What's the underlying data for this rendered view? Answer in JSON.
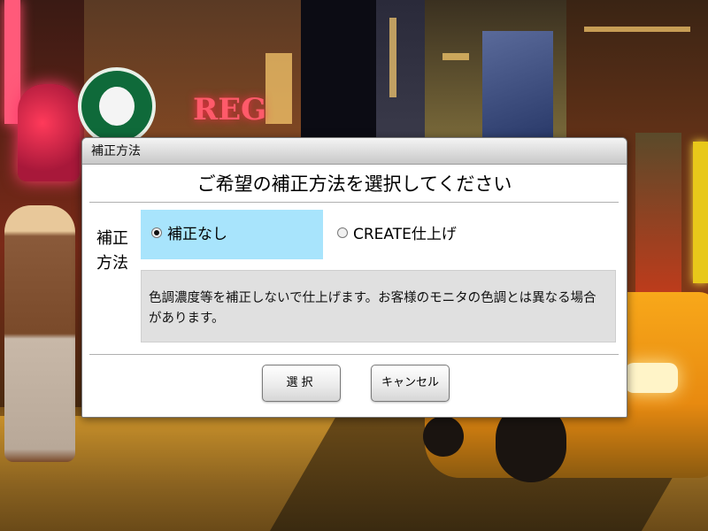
{
  "dialog": {
    "title": "補正方法",
    "heading": "ご希望の補正方法を選択してください",
    "side_label": "補正方法",
    "options": [
      {
        "label": "補正なし",
        "selected": true
      },
      {
        "label": "CREATE仕上げ",
        "selected": false
      }
    ],
    "description": "色調濃度等を補正しないで仕上げます。お客様のモニタの色調とは異なる場合があります。",
    "buttons": {
      "select_label": "選択",
      "cancel_label": "キャンセル"
    }
  },
  "colors": {
    "selected_option_bg": "#a8e4fc",
    "description_bg": "#e0e0e0"
  },
  "icons": [
    "radio-selected-icon",
    "radio-unselected-icon"
  ]
}
